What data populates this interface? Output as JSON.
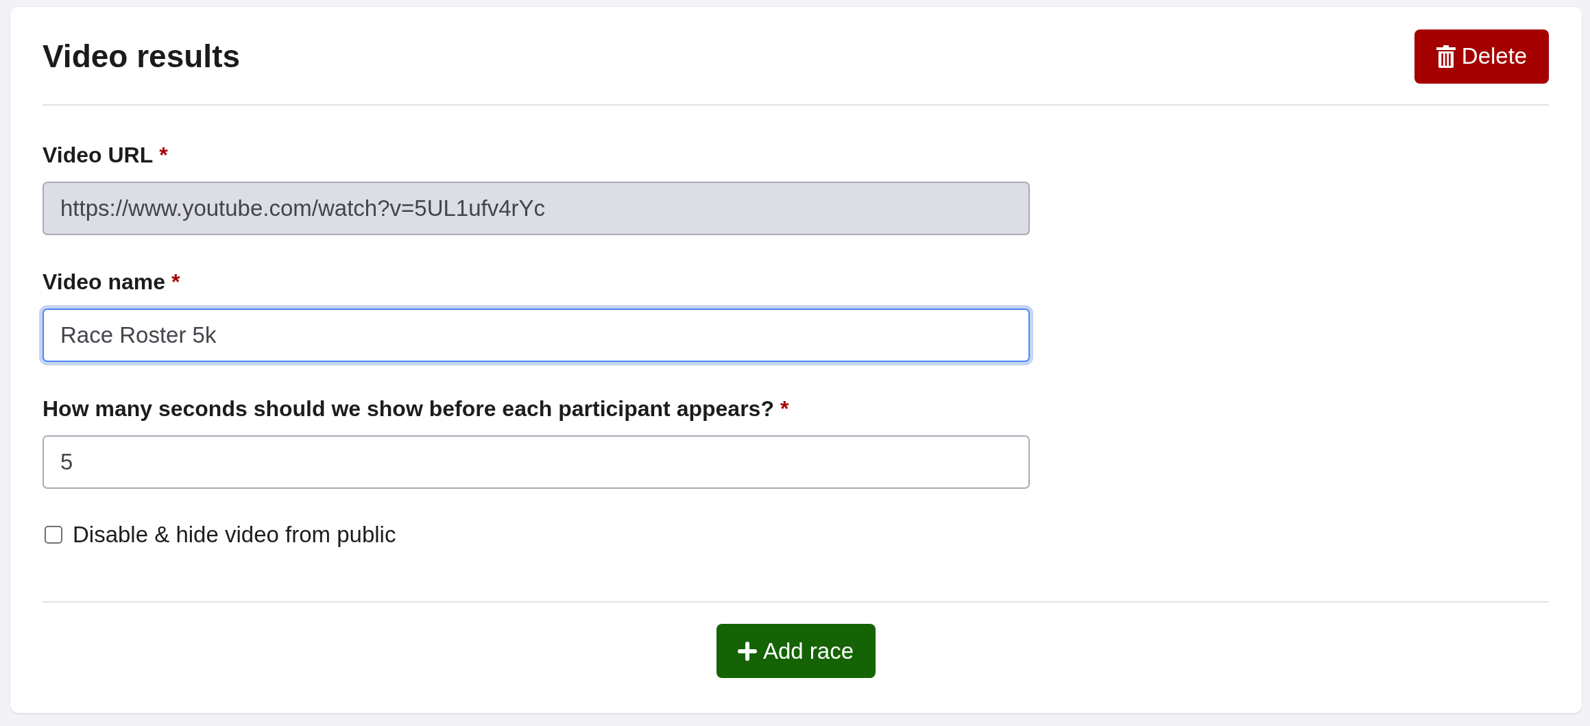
{
  "header": {
    "title": "Video results",
    "button": {
      "label": "Delete",
      "kind": "delete"
    }
  },
  "fields": [
    {
      "label": "Video URL",
      "required_mark": "*",
      "value": "https://www.youtube.com/watch?v=5UL1ufv4rYc",
      "disabled": true,
      "focused": false
    },
    {
      "label": "Video name",
      "required_mark": "*",
      "value": "Race Roster 5k",
      "disabled": false,
      "focused": true
    },
    {
      "label": "How many seconds should we show before each participant appears?",
      "required_mark": "*",
      "value": "5",
      "disabled": false,
      "focused": false
    }
  ],
  "checkbox": {
    "label": "Disable & hide video from public",
    "checked": false
  },
  "footer": {
    "button": {
      "label": "Add race",
      "kind": "add"
    }
  }
}
